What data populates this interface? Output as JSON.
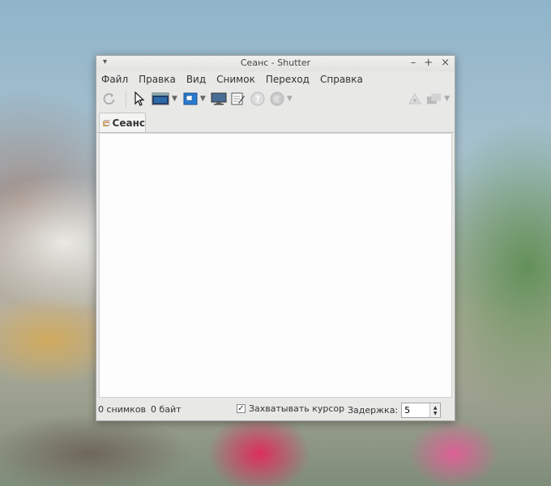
{
  "window": {
    "title": "Сеанс - Shutter"
  },
  "menubar": {
    "items": [
      "Файл",
      "Правка",
      "Вид",
      "Снимок",
      "Переход",
      "Справка"
    ]
  },
  "tabs": [
    {
      "label": "Сеанс"
    }
  ],
  "status": {
    "count": "0 снимков",
    "size": "0 байт",
    "capture_cursor_label": "Захватывать курсор",
    "capture_cursor_checked": true,
    "delay_label": "Задержка:",
    "delay_value": "5"
  },
  "icons": {
    "titlebar_menu": "chevron-down-icon",
    "minimize": "minimize-icon",
    "maximize": "maximize-icon",
    "close": "close-icon",
    "toolbar": [
      "refresh-icon",
      "cursor-icon",
      "window-capture-icon",
      "region-capture-icon",
      "desktop-capture-icon",
      "edit-icon",
      "help-icon",
      "web-icon",
      "upload-icon",
      "export-icon"
    ]
  },
  "colors": {
    "accent": "#2b7cd3",
    "window_bg": "#e8e8e7",
    "content_bg": "#fdfdfd"
  }
}
